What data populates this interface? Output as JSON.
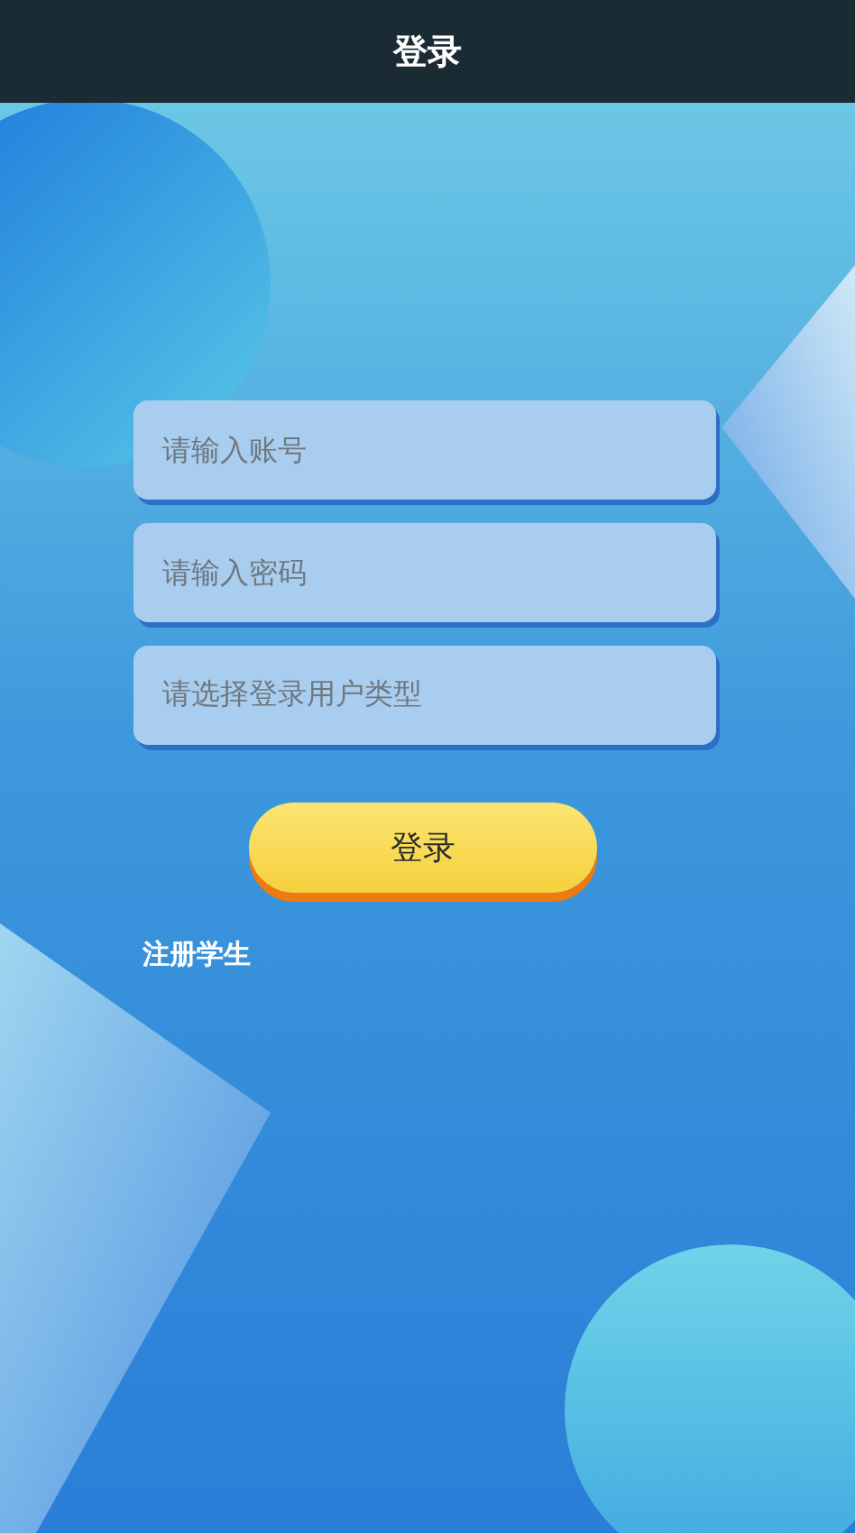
{
  "header": {
    "title": "登录"
  },
  "fields": [
    {
      "kind": "input",
      "placeholder": "请输入账号"
    },
    {
      "kind": "password",
      "placeholder": "请输入密码"
    },
    {
      "kind": "select",
      "placeholder": "请选择登录用户类型"
    }
  ],
  "login_button": {
    "label": "登录"
  },
  "register_link": {
    "label": "注册学生"
  }
}
